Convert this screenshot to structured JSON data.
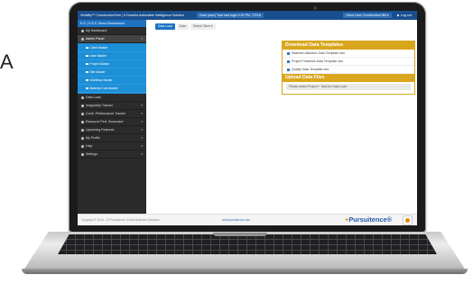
{
  "decor": {
    "side_letter": "A"
  },
  "topbar": {
    "app_title": "Visibility™ ConstructionTech | A Suvidha Actionable Intelligence Solution",
    "center_message": "Dear (user) Your last login 2:30 PM, 7/2/16",
    "user_button": "Client User Construction Bill ▾",
    "logout": "▶ Log out"
  },
  "sidebar": {
    "org": "E.S. | D.E.S. Demo Environment",
    "items_top": [
      {
        "label": "My Dashboard",
        "icon": "dashboard-icon"
      },
      {
        "label": "Admin Panel",
        "icon": "admin-icon",
        "caret": "▾"
      }
    ],
    "submenu": [
      "Client Master",
      "User Master",
      "Project Master",
      "Site Master",
      "Workflow Master",
      "Material Cost Master"
    ],
    "items_bottom": [
      {
        "label": "Data Load",
        "icon": "data-load-icon",
        "caret": ""
      },
      {
        "label": "Irregularity Tracker",
        "icon": "tracker-icon",
        "caret": "▾"
      },
      {
        "label": "Contr. Performance Tracker",
        "icon": "performance-icon",
        "caret": "▾"
      },
      {
        "label": "Resource Perf. Scorecard",
        "icon": "scorecard-icon",
        "caret": "▾"
      },
      {
        "label": "Upcoming Features",
        "icon": "features-icon",
        "caret": "▾"
      },
      {
        "label": "My Profile",
        "icon": "profile-icon",
        "caret": "▾"
      },
      {
        "label": "Help",
        "icon": "help-icon",
        "caret": "▾"
      },
      {
        "label": "Settings",
        "icon": "settings-icon",
        "caret": "▾"
      }
    ]
  },
  "breadcrumbs": [
    "Data Load",
    "Data",
    "Select Client ▾"
  ],
  "download_panel": {
    "title": "Download Data Templates",
    "items": [
      "Material Utilization Data Template.xlsx",
      "Project Timelines Data Template.xlsx",
      "Quality Data Template.xlsx"
    ]
  },
  "upload_panel": {
    "title": "Upload Data Files",
    "note": "Please select Project + Task for Data Load"
  },
  "footer": {
    "copyright": "Copyright © 2016 - 19 Pursuitence Global Business Solutions",
    "website": "www.pursuitence.com",
    "brand_prefix": "+",
    "brand_name": "Pursuitence",
    "brand_suffix": "®"
  }
}
